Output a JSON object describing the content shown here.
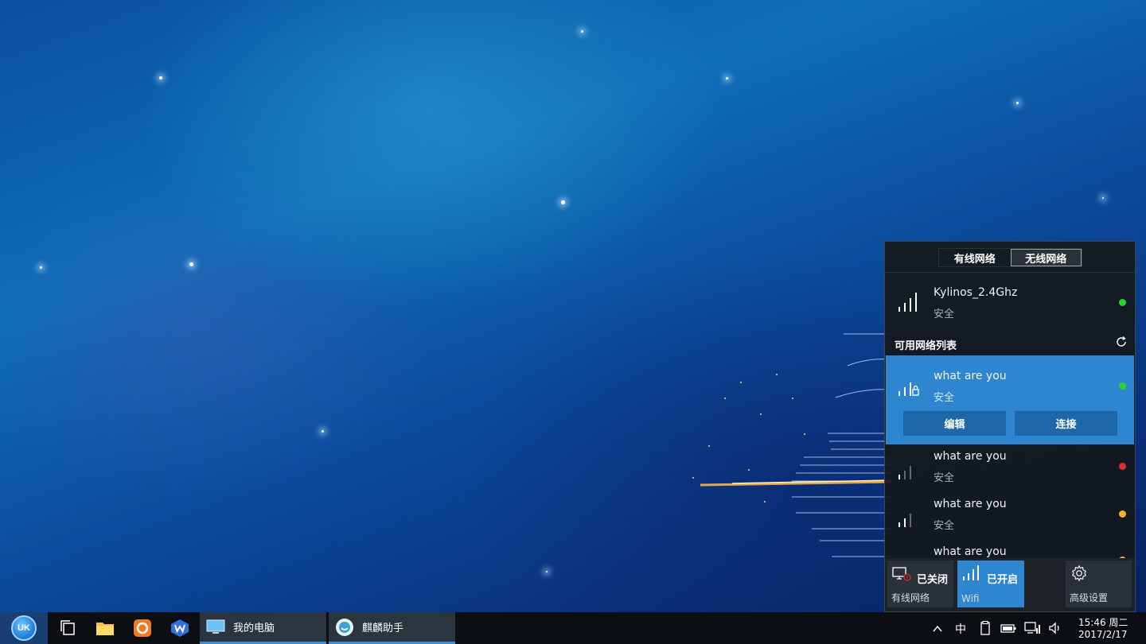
{
  "panel": {
    "tabs": [
      "有线网络",
      "无线网络"
    ],
    "active_tab": "无线网络",
    "connected": {
      "name": "Kylinos_2.4Ghz",
      "security": "安全",
      "status_color": "#27d627"
    },
    "list_title": "可用网络列表",
    "selected": {
      "name": "what are you",
      "security": "安全",
      "status_color": "#27d627",
      "edit_label": "编辑",
      "connect_label": "连接"
    },
    "networks": [
      {
        "name": "what are you",
        "security": "安全",
        "status_color": "#e02b2b"
      },
      {
        "name": "what are you",
        "security": "安全",
        "status_color": "#f0b534"
      },
      {
        "name": "what are you",
        "security": "",
        "status_color": "#f0b534"
      }
    ],
    "tiles": {
      "wired": {
        "state": "已关闭",
        "label": "有线网络"
      },
      "wifi": {
        "state": "已开启",
        "label": "Wifi"
      },
      "settings": {
        "label": "高级设置"
      }
    }
  },
  "taskbar": {
    "start_logo": "UK",
    "tasks": [
      {
        "label": "我的电脑",
        "icon": "computer-icon"
      },
      {
        "label": "麒麟助手",
        "icon": "assistant-icon"
      }
    ],
    "ime": "中",
    "time": "15:46 周二",
    "date": "2017/2/17"
  },
  "colors": {
    "accent": "#2e86d1",
    "taskbar": "#0b0f14"
  }
}
